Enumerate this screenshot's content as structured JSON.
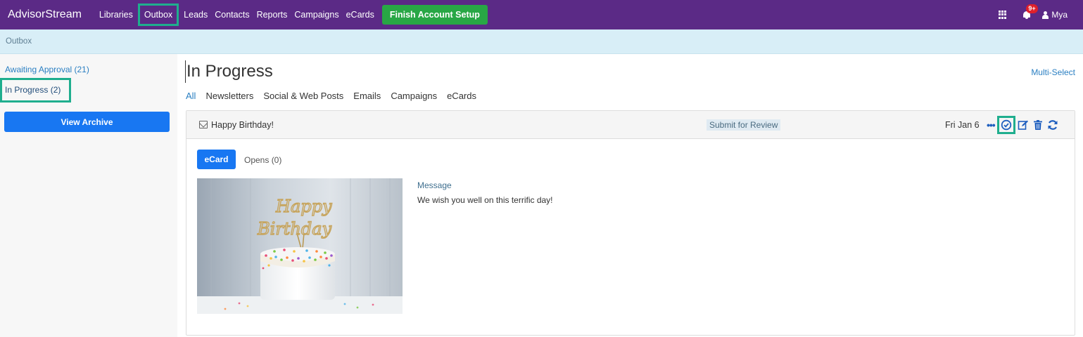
{
  "nav": {
    "brand": "AdvisorStream",
    "links": [
      "Libraries",
      "Outbox",
      "Leads",
      "Contacts",
      "Reports",
      "Campaigns",
      "eCards"
    ],
    "setup_label": "Finish Account Setup",
    "notification_count": "9+",
    "user_name": "Mya"
  },
  "breadcrumb": {
    "label": "Outbox"
  },
  "sidebar": {
    "awaiting": "Awaiting Approval (21)",
    "in_progress": "In Progress (2)",
    "archive_label": "View Archive"
  },
  "main": {
    "title": "In Progress",
    "multiselect": "Multi-Select",
    "tabs": [
      "All",
      "Newsletters",
      "Social & Web Posts",
      "Emails",
      "Campaigns",
      "eCards"
    ]
  },
  "card": {
    "title": "Happy Birthday!",
    "status": "Submit for Review",
    "date": "Fri Jan 6",
    "ecard_label": "eCard",
    "opens_label": "Opens (0)",
    "message_label": "Message",
    "message_text": "We wish you well on this terrific day!",
    "cake_topper_line1": "Happy",
    "cake_topper_line2": "Birthday"
  },
  "colors": {
    "nav_bg": "#5b2a86",
    "highlight": "#1fae8e",
    "primary": "#1877f2",
    "success": "#28a745"
  }
}
